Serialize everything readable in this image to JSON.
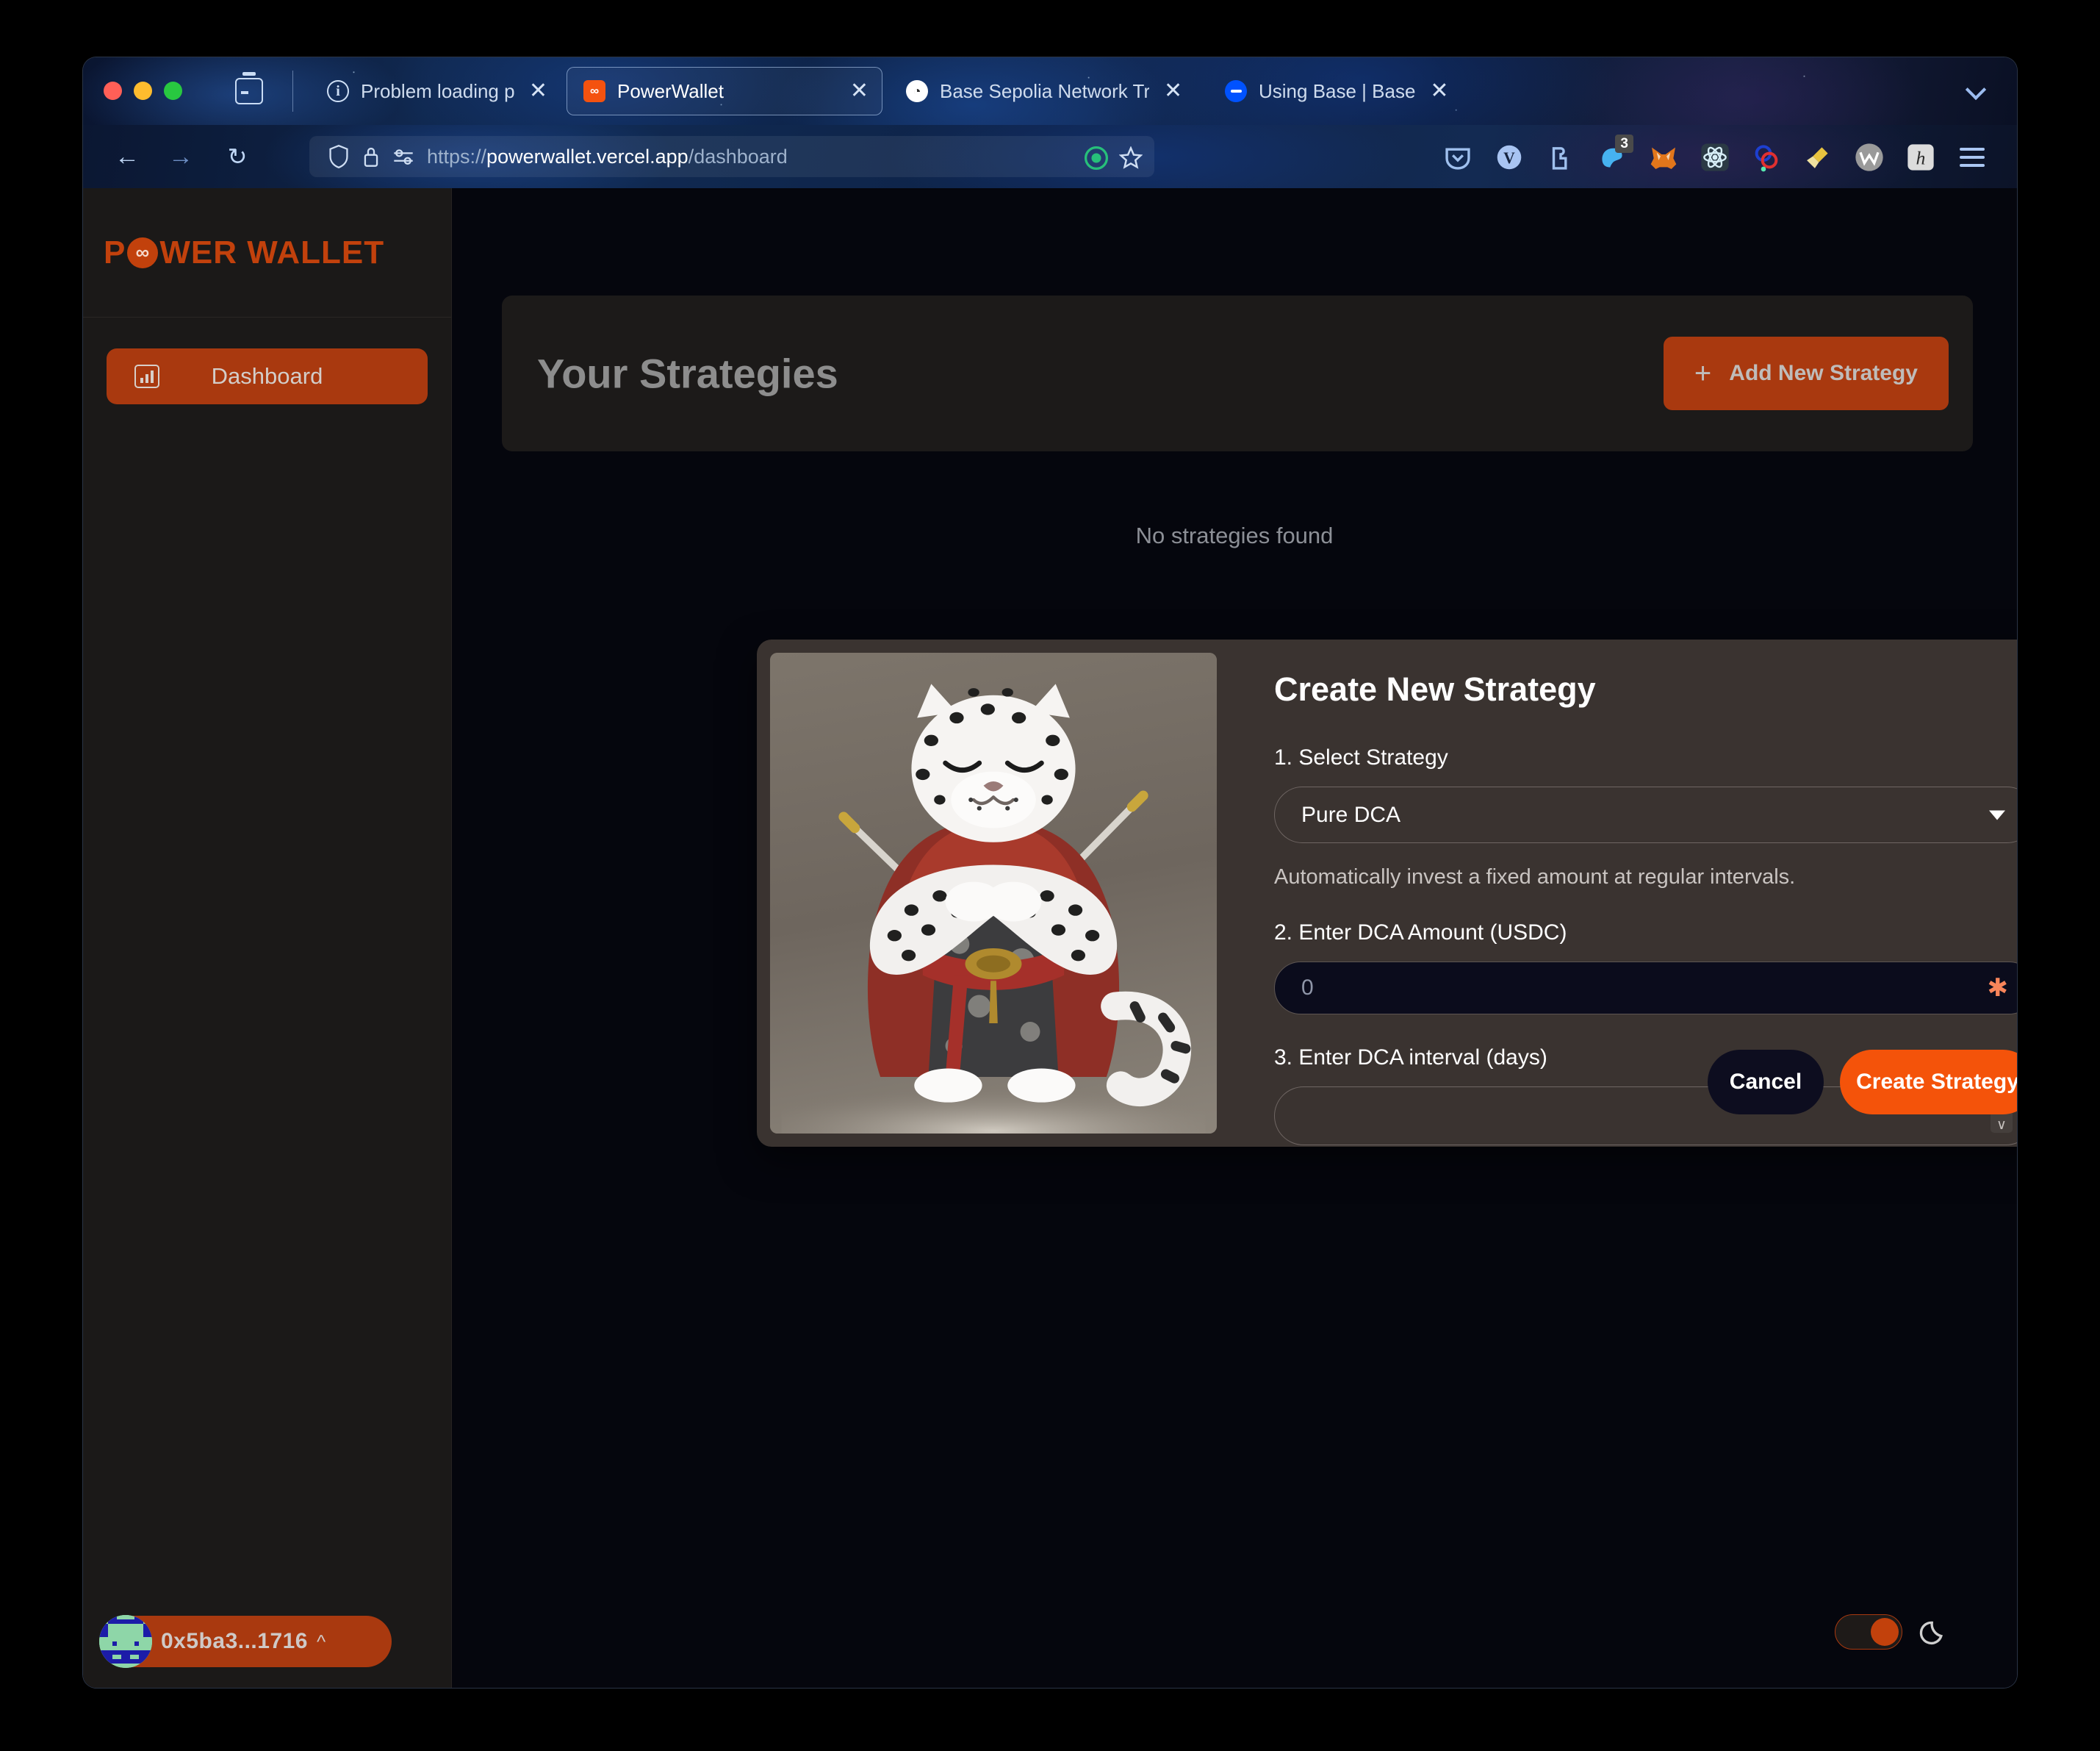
{
  "browser": {
    "tabs": [
      {
        "label": "Problem loading page",
        "favicon": "info-circle-icon",
        "active": false,
        "closable": true
      },
      {
        "label": "PowerWallet",
        "favicon": "powerwallet-icon",
        "active": true,
        "closable": true
      },
      {
        "label": "Base Sepolia Network Transacti",
        "favicon": "blockscout-icon",
        "active": false,
        "closable": true
      },
      {
        "label": "Using Base | Base",
        "favicon": "base-icon",
        "active": false,
        "closable": true
      }
    ],
    "tab_list_chevron": "chevron-down-icon",
    "nav": {
      "back": "back-arrow-icon",
      "forward": "forward-arrow-icon",
      "reload": "reload-icon"
    },
    "url": {
      "scheme": "https://",
      "host": "powerwallet.vercel.app",
      "path": "/dashboard",
      "full": "https://powerwallet.vercel.app/dashboard",
      "shield_icon": "shield-icon",
      "lock_icon": "lock-icon",
      "permissions_icon": "permissions-icon",
      "tracker_icon": "tracker-protection-icon",
      "bookmark_icon": "star-icon"
    },
    "extensions": [
      {
        "name": "pocket-icon",
        "badge": ""
      },
      {
        "name": "vimium-icon",
        "badge": ""
      },
      {
        "name": "puzzle-extensions-icon",
        "badge": ""
      },
      {
        "name": "rabby-wallet-icon",
        "badge": "3"
      },
      {
        "name": "metamask-fox-icon",
        "badge": ""
      },
      {
        "name": "react-devtools-icon",
        "badge": ""
      },
      {
        "name": "link-chain-icon",
        "badge": ""
      },
      {
        "name": "broom-icon",
        "badge": ""
      },
      {
        "name": "wappalyzer-icon",
        "badge": ""
      },
      {
        "name": "hypothesis-icon",
        "badge": ""
      }
    ],
    "menu_icon": "hamburger-menu-icon",
    "traffic_lights": [
      "close",
      "minimize",
      "zoom"
    ]
  },
  "sidebar": {
    "brand": {
      "before": "P",
      "circle": "∞",
      "after": "WER WALLET"
    },
    "items": [
      {
        "label": "Dashboard",
        "icon": "chart-bar-icon",
        "active": true
      }
    ],
    "wallet": {
      "address": "0x5ba3...1716",
      "caret": "chevron-up-icon",
      "avatar": "identicon-avatar"
    }
  },
  "main": {
    "header": {
      "title": "Your Strategies",
      "add_button": {
        "label": "Add New Strategy",
        "icon": "plus-icon"
      }
    },
    "empty_state": "No strategies found",
    "theme_toggle": {
      "state": "on",
      "icon": "moon-icon"
    }
  },
  "modal": {
    "title": "Create New Strategy",
    "image_alt": "snow-leopard-samurai-illustration",
    "fields": {
      "strategy": {
        "label": "1. Select Strategy",
        "value": "Pure DCA",
        "caret": "chevron-down-icon",
        "description": "Automatically invest a fixed amount at regular intervals."
      },
      "amount": {
        "label": "2. Enter DCA Amount (USDC)",
        "value": "0",
        "required_marker": "✱"
      },
      "interval": {
        "label": "3. Enter DCA interval (days)",
        "value": "",
        "placeholder": "",
        "spinner_up": "∧",
        "spinner_down": "∨"
      }
    },
    "actions": {
      "cancel": "Cancel",
      "create": "Create Strategy"
    }
  },
  "colors": {
    "brand_orange": "#c2410c",
    "accent_orange": "#f4530a",
    "sidebar_bg": "#1b1918",
    "page_bg": "#05060d",
    "modal_bg": "#3a3330"
  }
}
